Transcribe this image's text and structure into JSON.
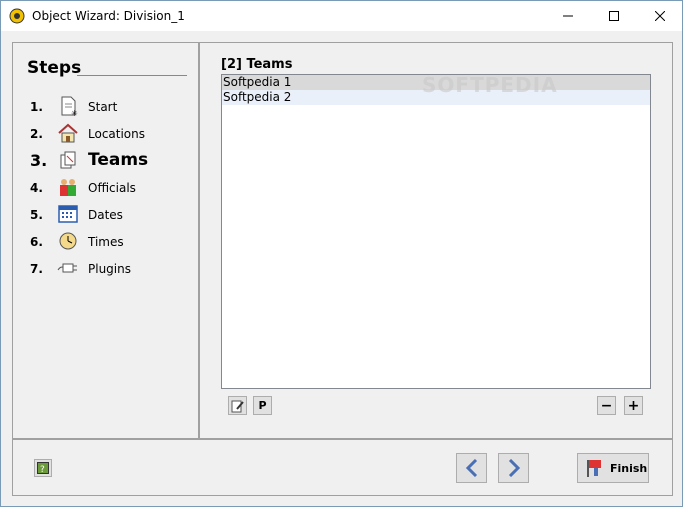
{
  "window": {
    "title": "Object Wizard: Division_1"
  },
  "steps": {
    "title": "Steps",
    "items": [
      {
        "num": "1.",
        "label": "Start",
        "icon": "document-icon"
      },
      {
        "num": "2.",
        "label": "Locations",
        "icon": "house-icon"
      },
      {
        "num": "3.",
        "label": "Teams",
        "icon": "teams-icon",
        "active": true
      },
      {
        "num": "4.",
        "label": "Officials",
        "icon": "officials-icon"
      },
      {
        "num": "5.",
        "label": "Dates",
        "icon": "calendar-icon"
      },
      {
        "num": "6.",
        "label": "Times",
        "icon": "clock-icon"
      },
      {
        "num": "7.",
        "label": "Plugins",
        "icon": "plug-icon"
      }
    ]
  },
  "main": {
    "title": "[2] Teams",
    "list": [
      "Softpedia 1",
      "Softpedia 2"
    ],
    "watermark": "SOFTPEDIA",
    "p_button": "P",
    "minus_button": "−",
    "plus_button": "+"
  },
  "footer": {
    "finish_label": "Finish"
  },
  "colors": {
    "accent": "#4a6fb5",
    "selection": "#d9d9d9"
  }
}
